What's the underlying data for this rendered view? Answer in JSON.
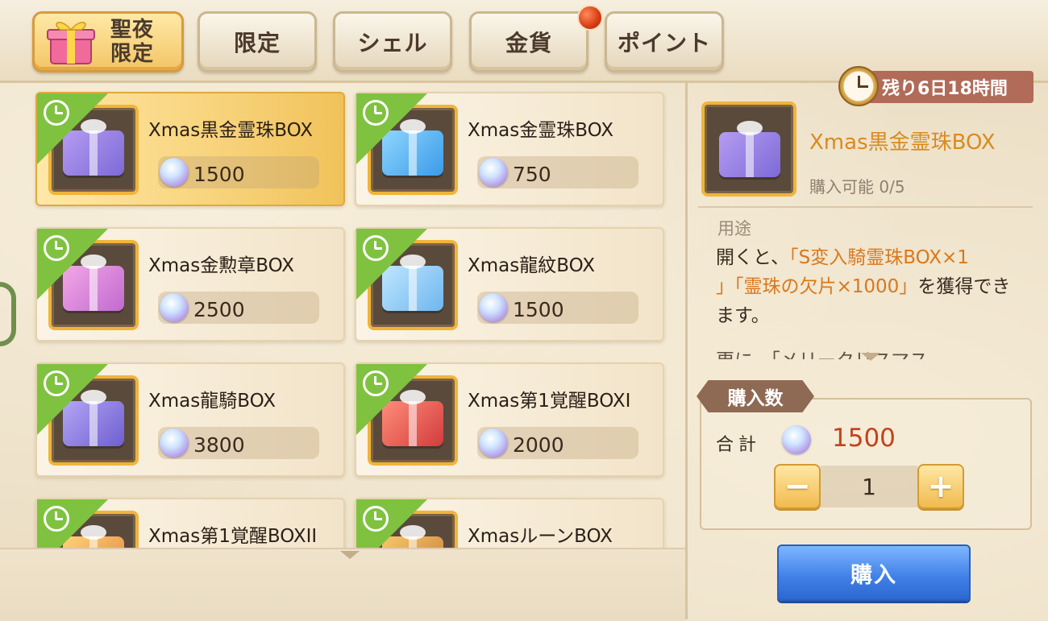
{
  "tabs": [
    {
      "label_line1": "聖夜",
      "label_line2": "限定",
      "active": true
    },
    {
      "label": "限定"
    },
    {
      "label": "シェル"
    },
    {
      "label": "金貨"
    },
    {
      "label": "ポイント"
    }
  ],
  "items": [
    {
      "name": "Xmas黒金霊珠BOX",
      "price": "1500"
    },
    {
      "name": "Xmas金霊珠BOX",
      "price": "750"
    },
    {
      "name": "Xmas金勲章BOX",
      "price": "2500"
    },
    {
      "name": "Xmas龍紋BOX",
      "price": "1500"
    },
    {
      "name": "Xmas龍騎BOX",
      "price": "3800"
    },
    {
      "name": "Xmas第1覚醒BOXI",
      "price": "2000"
    },
    {
      "name": "Xmas第1覚醒BOXII",
      "price": ""
    },
    {
      "name": "XmasルーンBOX",
      "price": ""
    }
  ],
  "detail": {
    "timer": "残り6日18時間",
    "name": "Xmas黒金霊珠BOX",
    "limit": "購入可能 0/5",
    "usage_label": "用途",
    "desc_before": "開くと、",
    "desc_hl1": "「S変入騎霊珠BOX×1",
    "desc_hl2": "」「霊珠の欠片×1000」",
    "desc_after": "を獲得できます。",
    "desc_more": "更に、「メリークリスマス"
  },
  "purchase": {
    "tag": "購入数",
    "total_label": "合計",
    "total_value": "1500",
    "minus": "−",
    "plus": "+",
    "quantity": "1",
    "buy_label": "購入"
  },
  "colors": {
    "accent_gold": "#f3c565",
    "price_red": "#c0441c",
    "highlight_orange": "#d9781c",
    "buy_blue": "#3f7fe6",
    "timer_bg": "#b16b58"
  }
}
